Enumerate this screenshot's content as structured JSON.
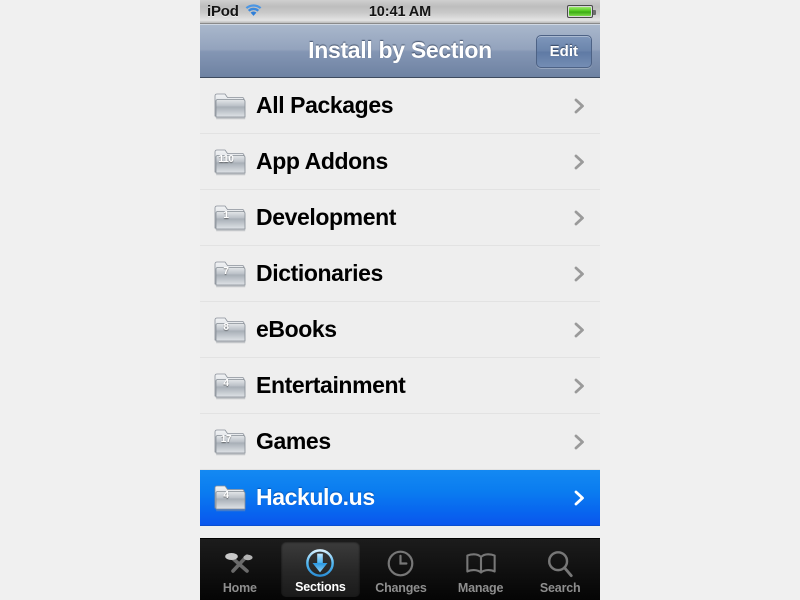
{
  "statusbar": {
    "carrier": "iPod",
    "wifi_icon": "wifi-icon",
    "time": "10:41 AM",
    "battery_icon": "battery-icon",
    "battery_color": "#4fc81e"
  },
  "navbar": {
    "title": "Install by Section",
    "edit_label": "Edit",
    "gradient_top": "#aab8cc",
    "gradient_bottom": "#6e82a2"
  },
  "list": {
    "accent_selected": "#0a7cf0",
    "rows": [
      {
        "label": "All Packages",
        "badge": "",
        "icon": "folder-icon",
        "chevron": "chevron-right-icon",
        "selected": false
      },
      {
        "label": "App Addons",
        "badge": "110",
        "icon": "folder-icon",
        "chevron": "chevron-right-icon",
        "selected": false
      },
      {
        "label": "Development",
        "badge": "1",
        "icon": "folder-icon",
        "chevron": "chevron-right-icon",
        "selected": false
      },
      {
        "label": "Dictionaries",
        "badge": "7",
        "icon": "folder-icon",
        "chevron": "chevron-right-icon",
        "selected": false
      },
      {
        "label": "eBooks",
        "badge": "8",
        "icon": "folder-icon",
        "chevron": "chevron-right-icon",
        "selected": false
      },
      {
        "label": "Entertainment",
        "badge": "4",
        "icon": "folder-icon",
        "chevron": "chevron-right-icon",
        "selected": false
      },
      {
        "label": "Games",
        "badge": "17",
        "icon": "folder-icon",
        "chevron": "chevron-right-icon",
        "selected": false
      },
      {
        "label": "Hackulo.us",
        "badge": "4",
        "icon": "folder-icon",
        "chevron": "chevron-right-icon",
        "selected": true
      }
    ]
  },
  "tabbar": {
    "tabs": [
      {
        "label": "Home",
        "icon": "cydia-logo-icon",
        "selected": false
      },
      {
        "label": "Sections",
        "icon": "download-arrow-icon",
        "selected": true
      },
      {
        "label": "Changes",
        "icon": "clock-icon",
        "selected": false
      },
      {
        "label": "Manage",
        "icon": "book-icon",
        "selected": false
      },
      {
        "label": "Search",
        "icon": "magnifier-icon",
        "selected": false
      }
    ]
  }
}
